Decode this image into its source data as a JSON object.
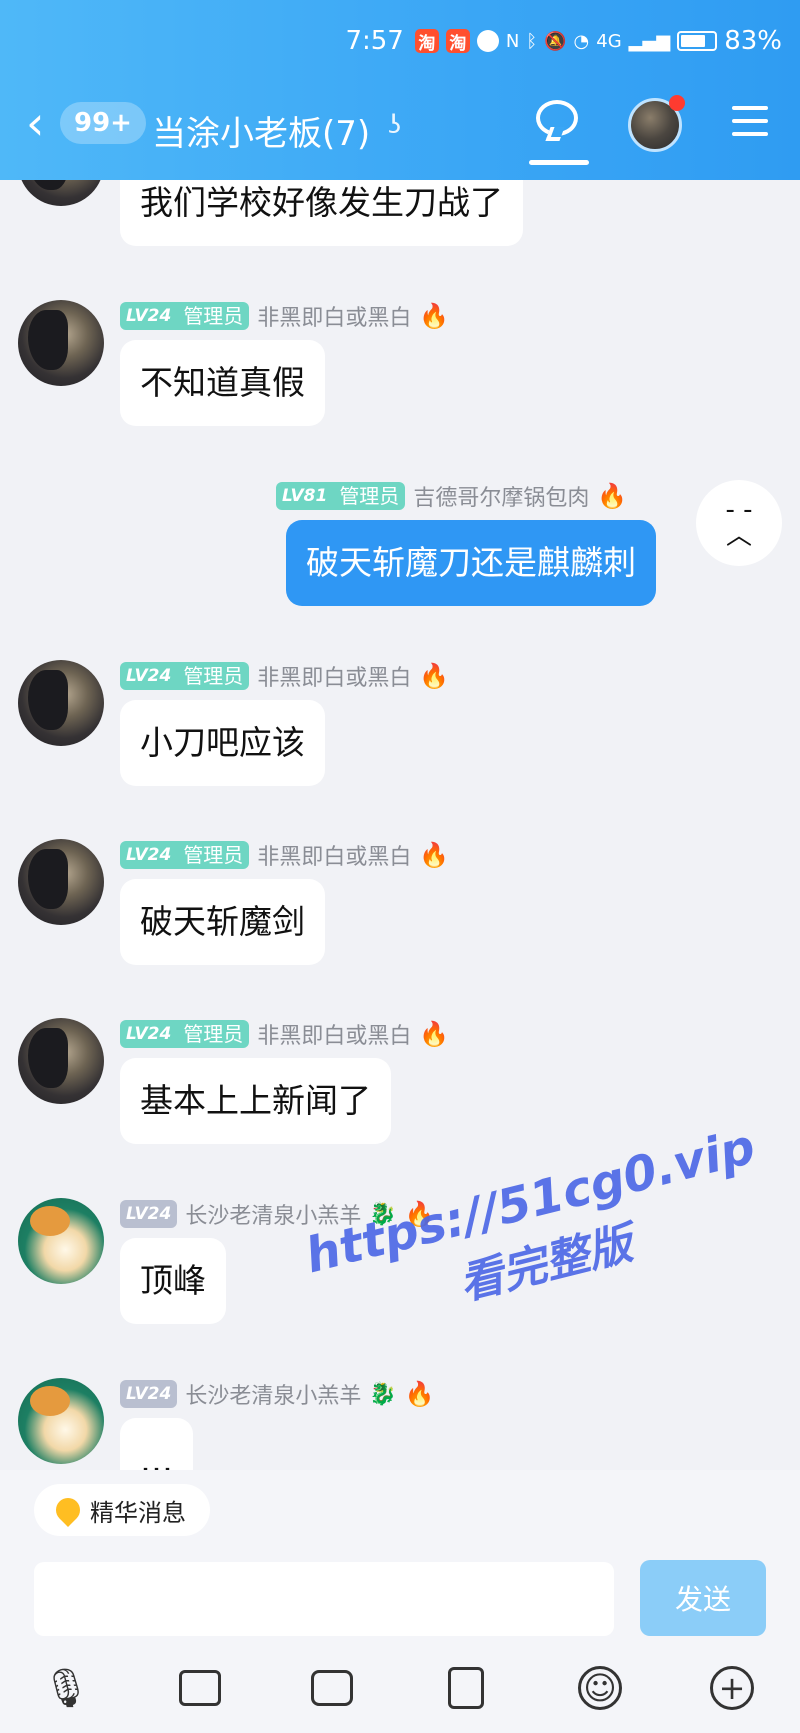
{
  "status_bar": {
    "time": "7:57",
    "app_icons": [
      "淘",
      "淘"
    ],
    "network": "4G",
    "battery": "83%"
  },
  "header": {
    "unread_badge": "99+",
    "title": "当涂小老板(7)",
    "ear_icon": "ear-icon"
  },
  "messages": [
    {
      "text": "我们学校好像发生刀战了"
    },
    {
      "level": "LV24",
      "role": "管理员",
      "nick": "非黑即白或黑白",
      "text": "不知道真假"
    },
    {
      "level": "LV81",
      "role": "管理员",
      "nick": "吉德哥尔摩锅包肉",
      "text": "破天斩魔刀还是麒麟刺",
      "self_avatar_face": "- -\n︿"
    },
    {
      "level": "LV24",
      "role": "管理员",
      "nick": "非黑即白或黑白",
      "text": "小刀吧应该"
    },
    {
      "level": "LV24",
      "role": "管理员",
      "nick": "非黑即白或黑白",
      "text": "破天斩魔剑"
    },
    {
      "level": "LV24",
      "role": "管理员",
      "nick": "非黑即白或黑白",
      "text": "基本上上新闻了"
    },
    {
      "level": "LV24",
      "nick": "长沙老清泉小羔羊",
      "text": "顶峰"
    },
    {
      "level": "LV24",
      "nick": "长沙老清泉小羔羊",
      "text": "…"
    }
  ],
  "bottom": {
    "essence_label": "精华消息",
    "send_label": "发送"
  },
  "watermark": {
    "line1": "https://51cg0.vip",
    "line2": "看完整版"
  },
  "colors": {
    "header_blue": "#3aa6f5",
    "my_bubble": "#2f97f4",
    "admin_tag": "#6ed6c3",
    "send_button": "#8bcdf8"
  }
}
